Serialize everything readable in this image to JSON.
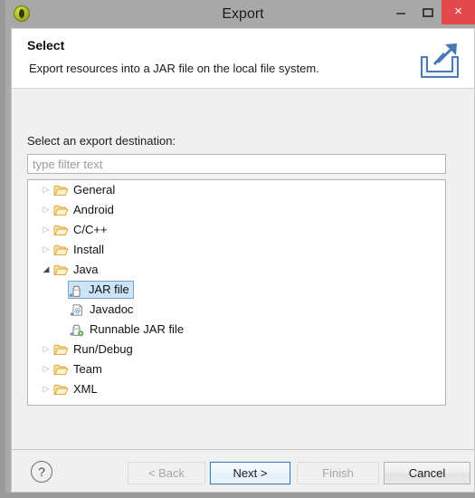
{
  "window": {
    "title": "Export",
    "app_icon": "eclipse-icon",
    "controls": {
      "minimize": "minimize-icon",
      "maximize": "maximize-icon",
      "close": "×",
      "close_color": "#e2484c"
    }
  },
  "header": {
    "title": "Select",
    "description": "Export resources into a JAR file on the local file system.",
    "icon": "export-wizard-icon",
    "icon_color": "#4a78b0"
  },
  "content": {
    "destination_label": "Select an export destination:",
    "filter": {
      "value": "",
      "placeholder": "type filter text"
    },
    "tree": [
      {
        "label": "General",
        "level": 0,
        "icon": "folder-icon",
        "expanded": false,
        "selected": false,
        "has_children": true
      },
      {
        "label": "Android",
        "level": 0,
        "icon": "folder-icon",
        "expanded": false,
        "selected": false,
        "has_children": true
      },
      {
        "label": "C/C++",
        "level": 0,
        "icon": "folder-icon",
        "expanded": false,
        "selected": false,
        "has_children": true
      },
      {
        "label": "Install",
        "level": 0,
        "icon": "folder-icon",
        "expanded": false,
        "selected": false,
        "has_children": true
      },
      {
        "label": "Java",
        "level": 0,
        "icon": "folder-icon",
        "expanded": true,
        "selected": false,
        "has_children": true
      },
      {
        "label": "JAR file",
        "level": 1,
        "icon": "jar-file-icon",
        "expanded": false,
        "selected": true,
        "has_children": false
      },
      {
        "label": "Javadoc",
        "level": 1,
        "icon": "javadoc-icon",
        "expanded": false,
        "selected": false,
        "has_children": false
      },
      {
        "label": "Runnable JAR file",
        "level": 1,
        "icon": "runnable-jar-icon",
        "expanded": false,
        "selected": false,
        "has_children": false
      },
      {
        "label": "Run/Debug",
        "level": 0,
        "icon": "folder-icon",
        "expanded": false,
        "selected": false,
        "has_children": true
      },
      {
        "label": "Team",
        "level": 0,
        "icon": "folder-icon",
        "expanded": false,
        "selected": false,
        "has_children": true
      },
      {
        "label": "XML",
        "level": 0,
        "icon": "folder-icon",
        "expanded": false,
        "selected": false,
        "has_children": true
      }
    ],
    "twisty_collapsed": "▷",
    "twisty_expanded": "◢"
  },
  "buttons": {
    "help": "?",
    "back": {
      "label": "< Back",
      "enabled": false
    },
    "next": {
      "label": "Next >",
      "enabled": true,
      "default": true
    },
    "finish": {
      "label": "Finish",
      "enabled": false
    },
    "cancel": {
      "label": "Cancel",
      "enabled": true
    }
  },
  "colors": {
    "selection_fill": "#cce4f7",
    "selection_border": "#7da2ce",
    "titlebar": "#a8a8a8",
    "dialog_bg": "#f0f0f0"
  }
}
